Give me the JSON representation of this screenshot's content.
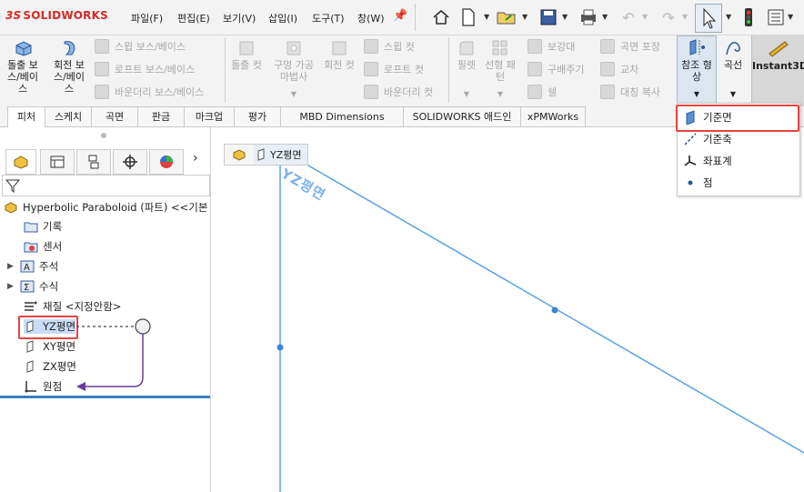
{
  "app": {
    "logo": "SOLIDWORKS"
  },
  "menu": [
    "파일(F)",
    "편집(E)",
    "보기(V)",
    "삽입(I)",
    "도구(T)",
    "창(W)"
  ],
  "ribbon": {
    "extrude_boss": "돌출 보\n스/베이\n스",
    "revolve_boss": "회전 보\n스/베이\n스",
    "swept_boss": "스윕 보스/베이스",
    "loft_boss": "로프트 보스/베이스",
    "boundary_boss": "바운더리 보스/베이스",
    "extrude_cut": "돌출 컷",
    "hole_wizard": "구멍 가공\n마법사",
    "revolve_cut": "회전 컷",
    "swept_cut": "스윕 컷",
    "loft_cut": "로프트 컷",
    "boundary_cut": "바운더리 컷",
    "fillet": "필렛",
    "linear_pattern": "선형 패\n턴",
    "rib": "보강대",
    "draft": "구배주기",
    "shell": "쉘",
    "wrap": "곡면 포장",
    "intersect": "교차",
    "mirror": "대칭 복사",
    "ref_geometry": "참조 형\n상",
    "curves": "곡선",
    "instant3d": "Instant3D"
  },
  "tabs": [
    "피처",
    "스케치",
    "곡면",
    "판금",
    "마크업",
    "평가",
    "MBD Dimensions",
    "SOLIDWORKS 애드인",
    "xPMWorks"
  ],
  "tree": {
    "root": "Hyperbolic Paraboloid (파트) <<기본",
    "items": [
      "기록",
      "센서",
      "주석",
      "수식",
      "재질 <지정안함>",
      "YZ평면",
      "XY평면",
      "ZX평면",
      "원점"
    ]
  },
  "viewport": {
    "breadcrumb_label": "YZ평면",
    "plane_label": "YZ평면"
  },
  "dropdown": {
    "items": [
      "기준면",
      "기준축",
      "좌표계",
      "점"
    ]
  },
  "colors": {
    "accent_red": "#e8423f",
    "plane_blue": "#5aa0e6",
    "arrow_purple": "#6a3d9a"
  }
}
